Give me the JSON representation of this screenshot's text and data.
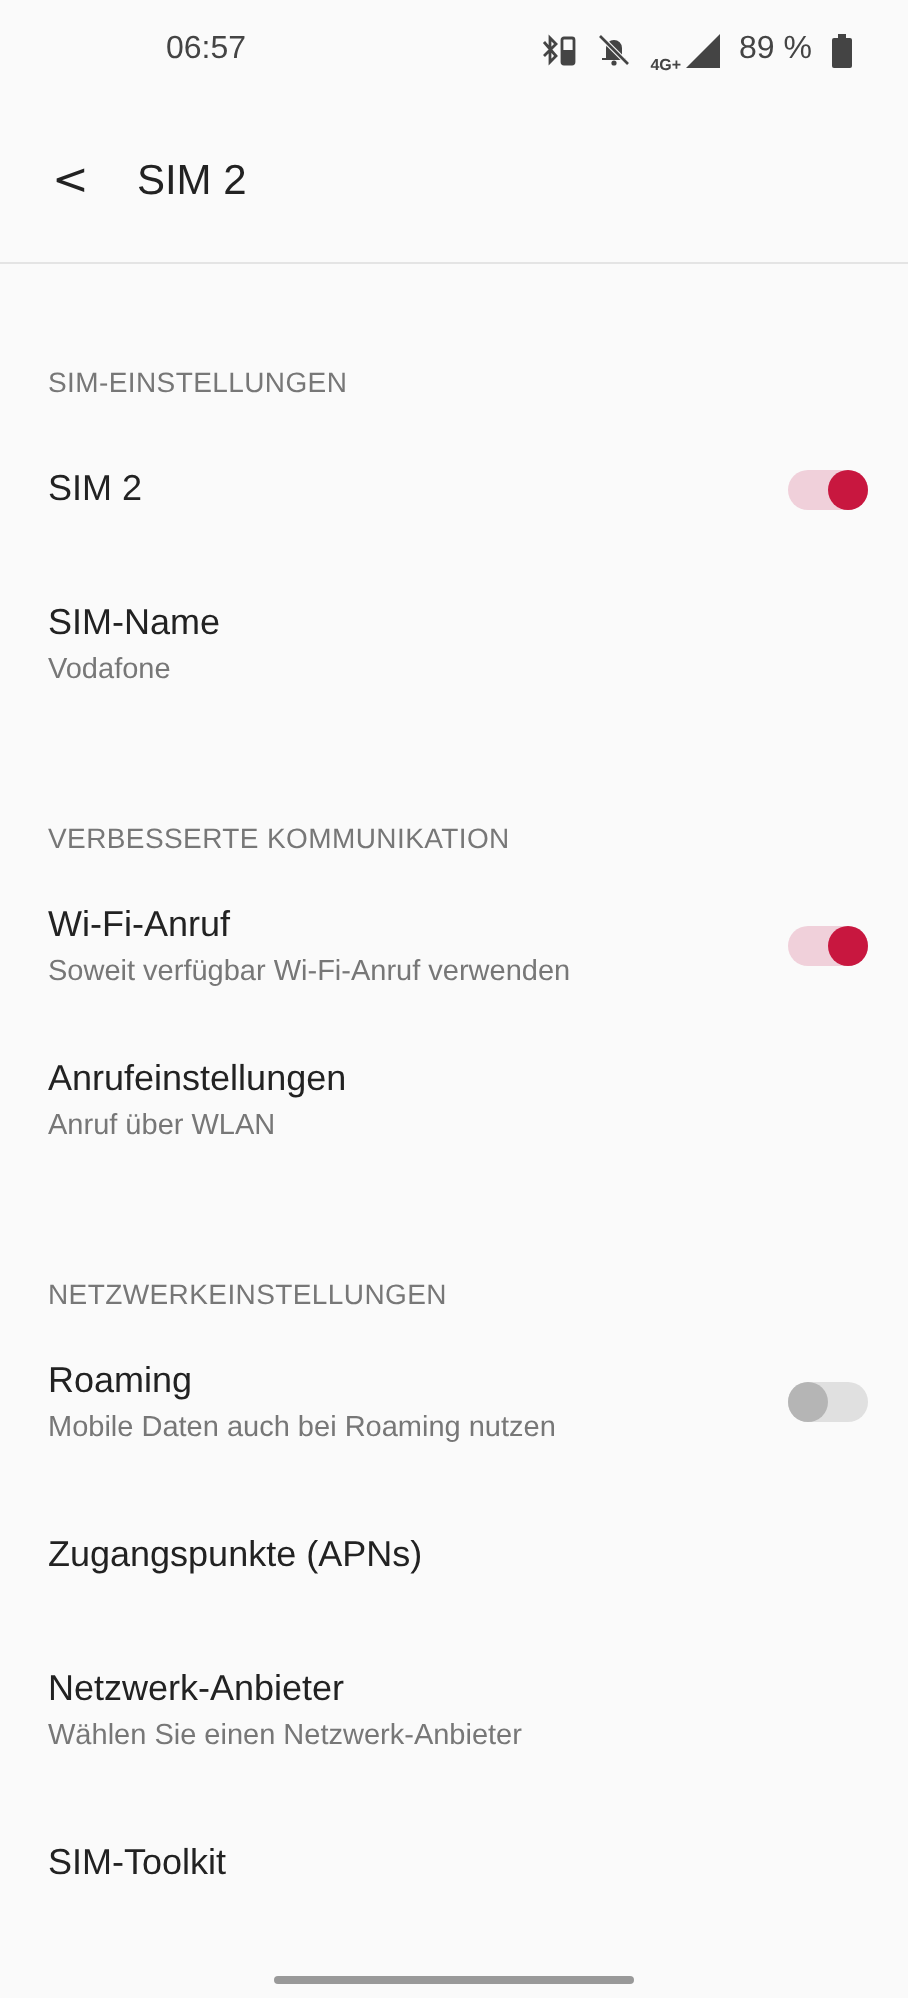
{
  "status_bar": {
    "time": "06:57",
    "network": "4G+",
    "battery": "89 %"
  },
  "header": {
    "back": "<",
    "title": "SIM 2"
  },
  "sections": [
    {
      "title": "SIM-EINSTELLUNGEN",
      "items": [
        {
          "kind": "toggle",
          "title": "SIM 2",
          "on": true
        },
        {
          "kind": "link",
          "title": "SIM-Name",
          "subtitle": "Vodafone"
        }
      ]
    },
    {
      "title": "VERBESSERTE KOMMUNIKATION",
      "items": [
        {
          "kind": "toggle",
          "title": "Wi-Fi-Anruf",
          "subtitle": "Soweit verfügbar Wi-Fi-Anruf verwenden",
          "on": true
        },
        {
          "kind": "link",
          "title": "Anrufeinstellungen",
          "subtitle": "Anruf über WLAN"
        }
      ]
    },
    {
      "title": "NETZWERKEINSTELLUNGEN",
      "items": [
        {
          "kind": "toggle",
          "title": "Roaming",
          "subtitle": "Mobile Daten auch bei Roaming nutzen",
          "on": false
        },
        {
          "kind": "link",
          "title": "Zugangspunkte (APNs)"
        },
        {
          "kind": "link",
          "title": "Netzwerk-Anbieter",
          "subtitle": "Wählen Sie einen Netzwerk-Anbieter"
        },
        {
          "kind": "link",
          "title": "SIM-Toolkit"
        }
      ]
    }
  ]
}
